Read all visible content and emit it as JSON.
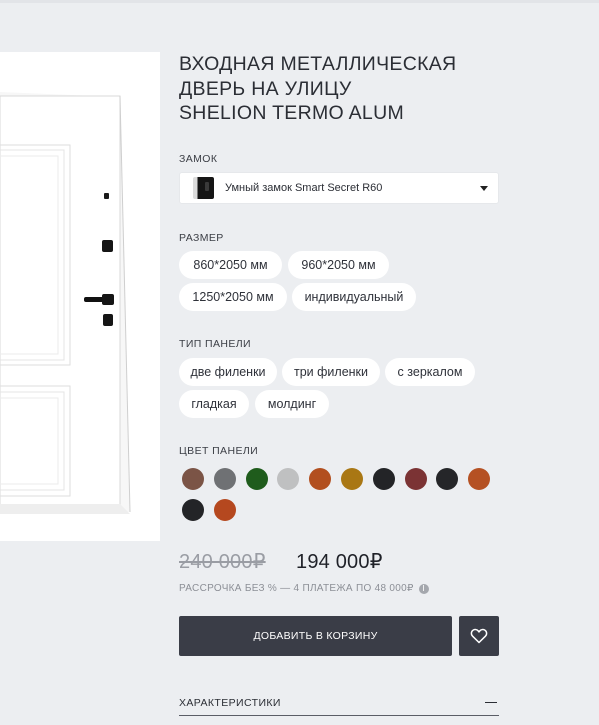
{
  "product": {
    "title_lines": [
      "ВХОДНАЯ МЕТАЛЛИЧЕСКАЯ",
      "ДВЕРЬ НА УЛИЦУ",
      "SHELION TERMO ALUM"
    ]
  },
  "lock": {
    "label": "ЗАМОК",
    "selected": "Умный замок Smart Secret R60",
    "icon": "chevron-down-icon"
  },
  "size": {
    "label": "РАЗМЕР",
    "options": [
      "860*2050 мм",
      "960*2050 мм",
      "1250*2050 мм",
      "индивидуальный"
    ]
  },
  "panel_type": {
    "label": "ТИП ПАНЕЛИ",
    "options": [
      "две филенки",
      "три филенки",
      "с зеркалом",
      "гладкая",
      "молдинг"
    ]
  },
  "panel_color": {
    "label": "ЦВЕТ ПАНЕЛИ",
    "swatches": [
      "#7b5446",
      "#6f7174",
      "#1f5c1c",
      "#bfc0c1",
      "#b24f1f",
      "#a97714",
      "#232427",
      "#7b3334",
      "#252629",
      "#b55123",
      "#232427",
      "#b5481f"
    ]
  },
  "pricing": {
    "old_price": "240 000₽",
    "price": "194 000₽",
    "installment": "РАССРОЧКА БЕЗ % — 4 ПЛАТЕЖА ПО 48 000₽",
    "info_icon": "i"
  },
  "actions": {
    "add_to_cart": "ДОБАВИТЬ В КОРЗИНУ",
    "favorite_icon": "heart-icon"
  },
  "accordion": {
    "label": "ХАРАКТЕРИСТИКИ",
    "icon": "minus-icon"
  }
}
